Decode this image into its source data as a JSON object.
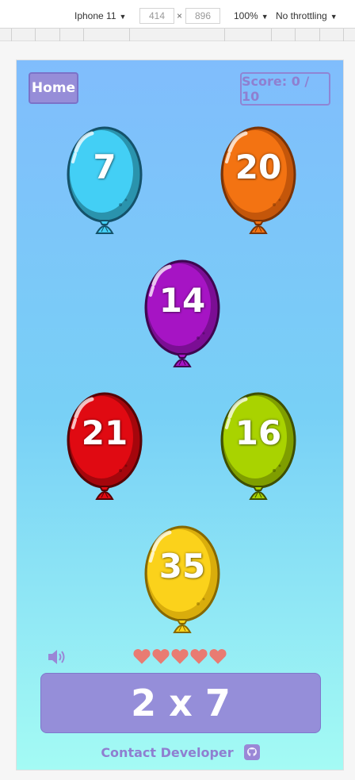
{
  "devtools": {
    "device": "Iphone 11",
    "width": "414",
    "height": "896",
    "times": "×",
    "zoom": "100%",
    "throttling": "No throttling"
  },
  "header": {
    "home_label": "Home",
    "score_label": "Score: 0 / 10"
  },
  "balloons": [
    {
      "number": "7",
      "color": "#43cff5",
      "dark": "#2a93ad",
      "border": "#14526a"
    },
    {
      "number": "20",
      "color": "#f37312",
      "dark": "#c4560a",
      "border": "#7a3306"
    },
    {
      "number": "14",
      "color": "#a614c4",
      "dark": "#7b0e94",
      "border": "#3e0650"
    },
    {
      "number": "21",
      "color": "#e00a12",
      "dark": "#a5060c",
      "border": "#560305"
    },
    {
      "number": "16",
      "color": "#a9d300",
      "dark": "#7f9e00",
      "border": "#3e4f00"
    },
    {
      "number": "35",
      "color": "#fbd21b",
      "dark": "#d9ad0c",
      "border": "#866800"
    }
  ],
  "lives": {
    "remaining": 5,
    "max": 5,
    "color": "#e97b72"
  },
  "sound": {
    "icon": "speaker-icon",
    "color": "#9a87d6"
  },
  "question": {
    "text": "2 x 7"
  },
  "footer": {
    "contact_label": "Contact Developer",
    "icon": "github-icon"
  }
}
